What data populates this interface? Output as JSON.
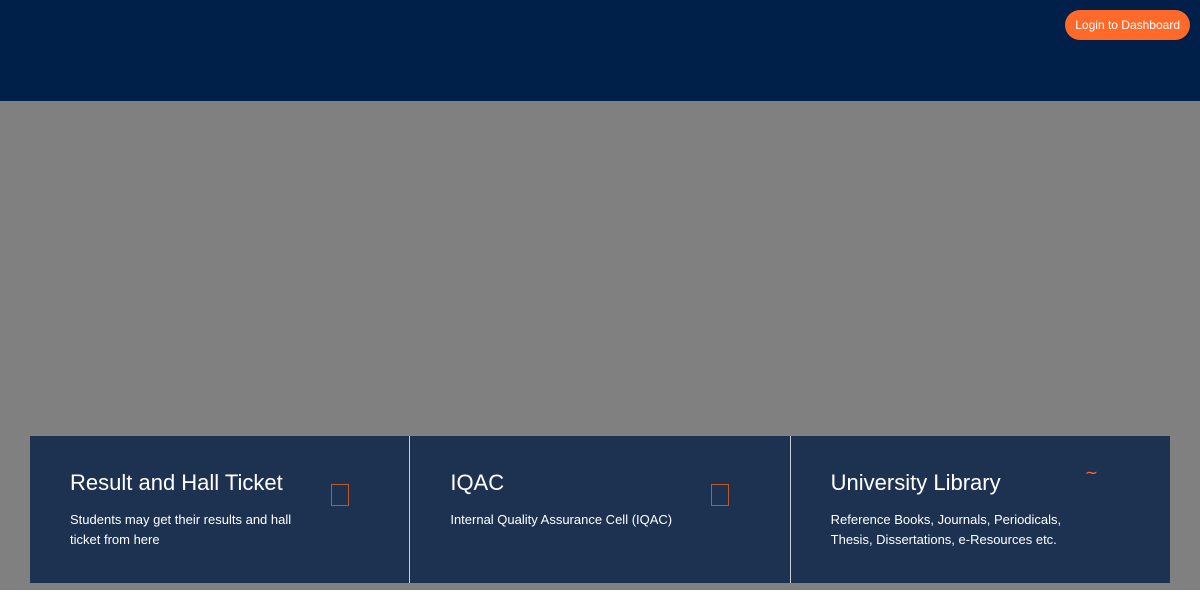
{
  "header": {
    "login_label": "Login to Dashboard"
  },
  "cards": [
    {
      "title": "Result and Hall Ticket",
      "description": "Students may get their results and hall ticket from here",
      "icon": "missing-glyph-icon"
    },
    {
      "title": "IQAC",
      "description": "Internal Quality Assurance Cell (IQAC)",
      "icon": "missing-glyph-icon"
    },
    {
      "title": "University Library",
      "description": "Reference Books, Journals, Periodicals, Thesis, Dissertations, e-Resources etc.",
      "icon": "tilde-icon",
      "icon_glyph": "~"
    }
  ],
  "colors": {
    "header_bg": "#00204a",
    "accent": "#ff6a2b",
    "hero_bg": "#808080",
    "card_bg": "#1d3150"
  }
}
